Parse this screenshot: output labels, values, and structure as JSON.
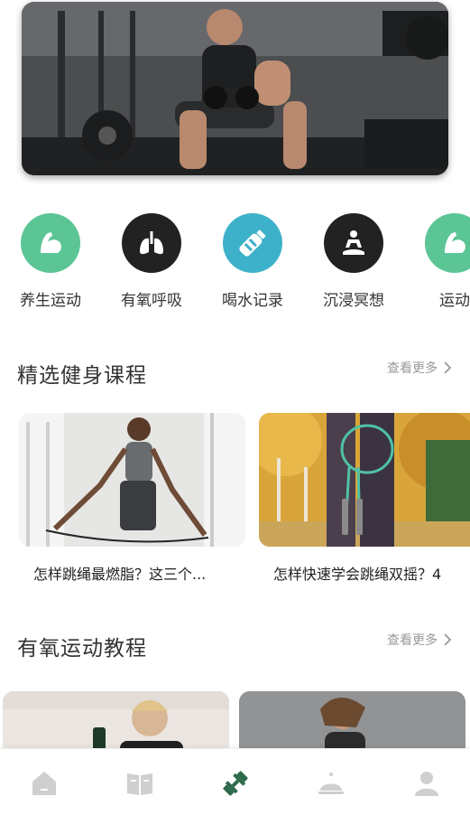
{
  "quick_links": [
    {
      "label": "养生运动",
      "icon": "arm-muscle-icon",
      "color": "#5cc595"
    },
    {
      "label": "有氧呼吸",
      "icon": "lungs-icon",
      "color": "#222222"
    },
    {
      "label": "喝水记录",
      "icon": "water-bottle-icon",
      "color": "#3db1c9"
    },
    {
      "label": "沉浸冥想",
      "icon": "meditation-icon",
      "color": "#222222"
    },
    {
      "label": "运动",
      "icon": "arm-muscle-icon",
      "color": "#5cc595"
    }
  ],
  "sections": {
    "fitness": {
      "title": "精选健身课程",
      "more": "查看更多",
      "cards": [
        {
          "title": "怎样跳绳最燃脂？这三个..."
        },
        {
          "title": "怎样快速学会跳绳双摇？4"
        }
      ]
    },
    "aerobic": {
      "title": "有氧运动教程",
      "more": "查看更多"
    }
  },
  "tabbar": [
    {
      "icon": "home-icon",
      "active": false
    },
    {
      "icon": "book-icon",
      "active": false
    },
    {
      "icon": "dumbbell-icon",
      "active": true
    },
    {
      "icon": "food-cloche-icon",
      "active": false
    },
    {
      "icon": "profile-icon",
      "active": false
    }
  ],
  "colors": {
    "accent": "#2e6b4c",
    "inactive": "#cfcfcf"
  }
}
